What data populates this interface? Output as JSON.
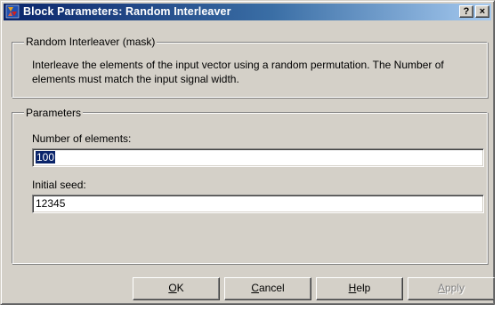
{
  "window": {
    "title": "Block Parameters: Random Interleaver",
    "help_caption": "?",
    "close_caption": "×"
  },
  "mask_group": {
    "legend": "Random Interleaver (mask)",
    "description": "Interleave the elements of the input vector using a random permutation.  The Number of elements must match the input signal width."
  },
  "parameters_group": {
    "legend": "Parameters",
    "fields": [
      {
        "label": "Number of elements:",
        "value": "100",
        "selected": true
      },
      {
        "label": "Initial seed:",
        "value": "12345",
        "selected": false
      }
    ]
  },
  "buttons": {
    "ok": {
      "mnemonic": "O",
      "rest": "K"
    },
    "cancel": {
      "mnemonic": "C",
      "rest": "ancel"
    },
    "help": {
      "mnemonic": "H",
      "rest": "elp"
    },
    "apply": {
      "mnemonic": "A",
      "rest": "pply",
      "enabled": false
    }
  },
  "colors": {
    "title_gradient_start": "#0a246a",
    "title_gradient_end": "#a6caf0",
    "dialog_face": "#d4d0c8",
    "selection": "#0a246a"
  }
}
